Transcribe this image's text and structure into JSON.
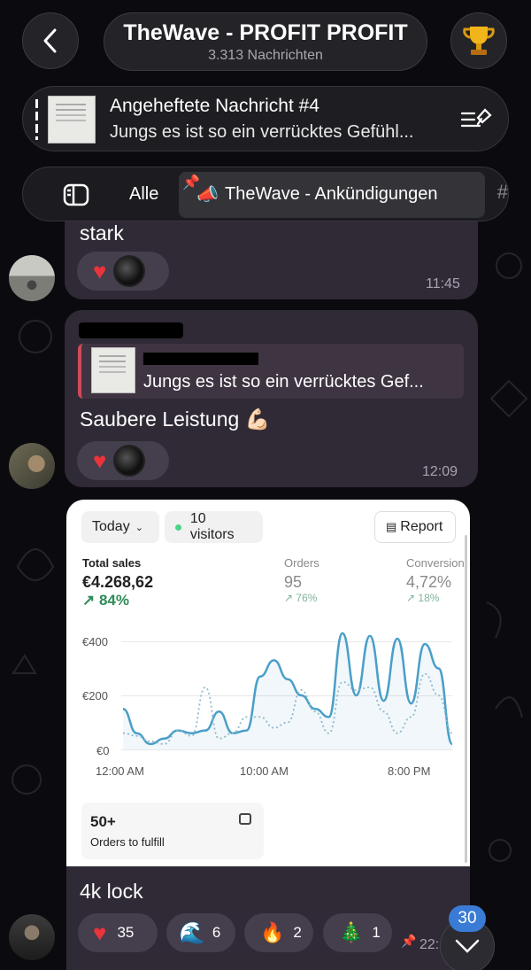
{
  "header": {
    "title": "TheWave - PROFIT PROFIT",
    "subtitle": "3.313 Nachrichten",
    "back_icon": "chevron-left-icon",
    "trophy_icon": "trophy-icon"
  },
  "pinned": {
    "title": "Angeheftete Nachricht #4",
    "text": "Jungs es ist so ein verrücktes Gefühl..."
  },
  "filters": {
    "all_label": "Alle",
    "channel_label": "TheWave - Ankündigungen",
    "hash": "#"
  },
  "messages": [
    {
      "text": "stark",
      "time": "11:45",
      "reaction": "❤️"
    },
    {
      "reply_text": "Jungs es ist so ein verrücktes Gef...",
      "text": "Saubere Leistung 💪🏻",
      "time": "12:09",
      "reaction": "❤️"
    }
  ],
  "dashboard": {
    "period": "Today",
    "visitors": "10 visitors",
    "report": "Report",
    "stats": [
      {
        "label": "Total sales",
        "value": "€4.268,62",
        "change": "↗ 84%"
      },
      {
        "label": "Orders",
        "value": "95",
        "change": "↗ 76%"
      },
      {
        "label": "Conversion",
        "value": "4,72%",
        "change": "↗ 18%"
      }
    ],
    "y_ticks": [
      "€400",
      "€200",
      "€0"
    ],
    "x_ticks": [
      "12:00 AM",
      "10:00 AM",
      "8:00 PM"
    ],
    "fulfill_count": "50+",
    "fulfill_label": "Orders to fulfill",
    "colors": {
      "today": "#4a9fc8",
      "previous": "#8fb9cc",
      "positive": "#2e8b57"
    }
  },
  "chart_data": {
    "type": "line",
    "ylim": [
      0,
      450
    ],
    "series": [
      {
        "values": [
          150,
          60,
          20,
          40,
          70,
          60,
          70,
          140,
          60,
          70,
          270,
          330,
          260,
          200,
          150,
          120,
          430,
          200,
          420,
          180,
          410,
          170,
          390,
          300,
          20
        ]
      },
      {
        "values": [
          60,
          50,
          30,
          20,
          70,
          50,
          230,
          40,
          60,
          120,
          120,
          80,
          100,
          220,
          140,
          60,
          250,
          220,
          230,
          140,
          60,
          120,
          280,
          200,
          60
        ]
      }
    ]
  },
  "last_message": {
    "text": "4k lock",
    "reactions": [
      {
        "emoji": "❤️",
        "count": "35"
      },
      {
        "emoji": "🌊",
        "count": "6"
      },
      {
        "emoji": "🔥",
        "count": "2"
      },
      {
        "emoji": "🎄",
        "count": "1"
      }
    ],
    "time": "22:",
    "unread_count": "30"
  }
}
